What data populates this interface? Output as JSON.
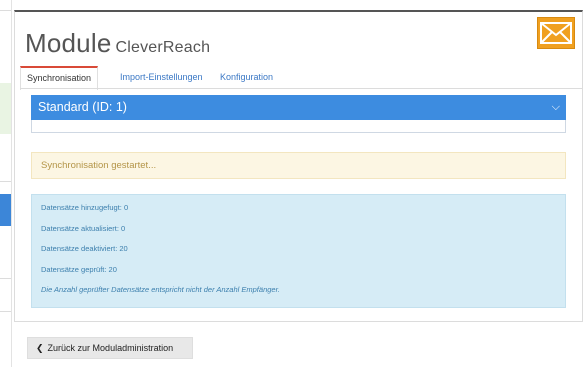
{
  "module": {
    "title_main": "Module",
    "title_sub": "CleverReach",
    "icon": "mail-icon",
    "accent_color": "#f0a020"
  },
  "tabs": [
    {
      "label": "Synchronisation",
      "active": true
    },
    {
      "label": "Import-Einstellungen",
      "active": false
    },
    {
      "label": "Konfiguration",
      "active": false
    }
  ],
  "select": {
    "value": "Standard (ID: 1)",
    "color": "#3d8ce0"
  },
  "alerts": {
    "warning_text": "Synchronisation gestartet...",
    "info_lines": [
      "Datensätze hinzugefugt: 0",
      "Datensätze aktualisiert: 0",
      "Datensätze deaktiviert: 20",
      "Datensätze geprüft: 20"
    ],
    "info_note": "Die Anzahl geprüfter Datensätze entspricht nicht der Anzahl Empfänger."
  },
  "back_button": {
    "label": "Zurück zur Moduladministration"
  }
}
